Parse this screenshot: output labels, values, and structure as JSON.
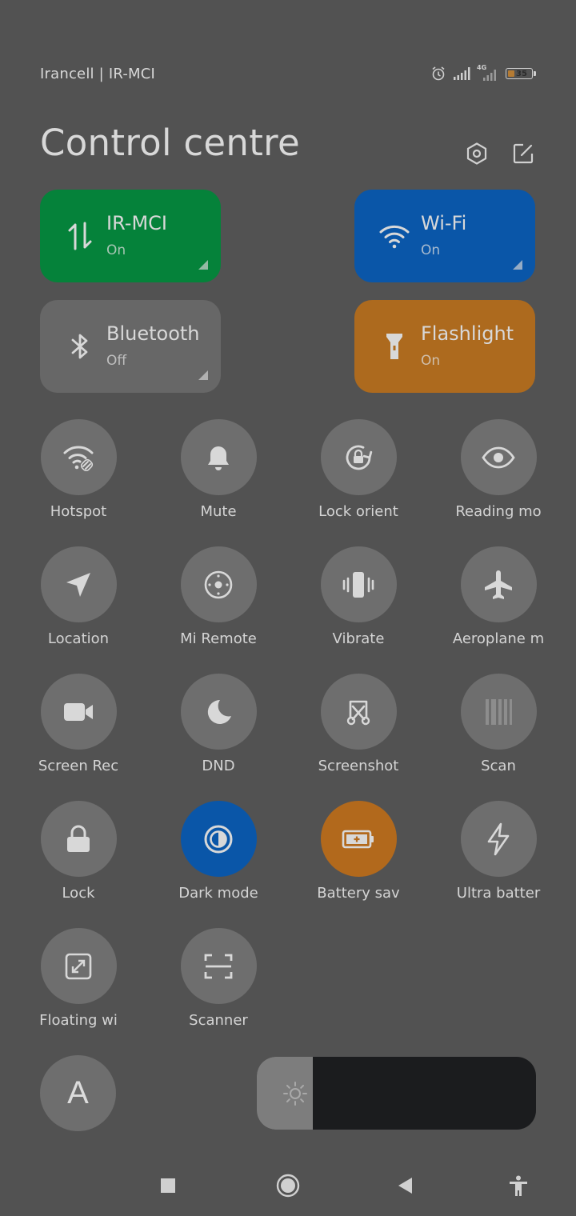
{
  "status": {
    "carrier": "Irancell | IR-MCI",
    "network_label": "4G",
    "battery": "35"
  },
  "header": {
    "title": "Control centre",
    "settings_icon": "hexagon-settings-icon",
    "edit_icon": "edit-icon"
  },
  "big_tiles": [
    {
      "name": "IR-MCI",
      "state": "On",
      "color": "#05823a",
      "icon": "data-arrows-icon"
    },
    {
      "name": "Wi-Fi",
      "state": "On",
      "color": "#0a56a8",
      "icon": "wifi-icon"
    },
    {
      "name": "Bluetooth",
      "state": "Off",
      "color": "#676767",
      "icon": "bluetooth-icon"
    },
    {
      "name": "Flashlight",
      "state": "On",
      "color": "#ad6a1e",
      "icon": "flashlight-icon"
    }
  ],
  "toggles": [
    {
      "label": "Hotspot"
    },
    {
      "label": "Mute"
    },
    {
      "label": "Lock orient"
    },
    {
      "label": "Reading mo"
    },
    {
      "label": "Location"
    },
    {
      "label": "Mi Remote"
    },
    {
      "label": "Vibrate"
    },
    {
      "label": "Aeroplane m"
    },
    {
      "label": "Screen Rec"
    },
    {
      "label": "DND"
    },
    {
      "label": "Screenshot"
    },
    {
      "label": "Scan"
    },
    {
      "label": "Lock"
    },
    {
      "label": "Dark mode"
    },
    {
      "label": "Battery sav"
    },
    {
      "label": "Ultra batter"
    },
    {
      "label": "Floating wi"
    },
    {
      "label": "Scanner"
    }
  ],
  "font_button": "A",
  "brightness": {
    "level": 0.2
  },
  "nav": [
    "recents-square-icon",
    "home-circle-icon",
    "back-triangle-icon",
    "accessibility-icon"
  ]
}
